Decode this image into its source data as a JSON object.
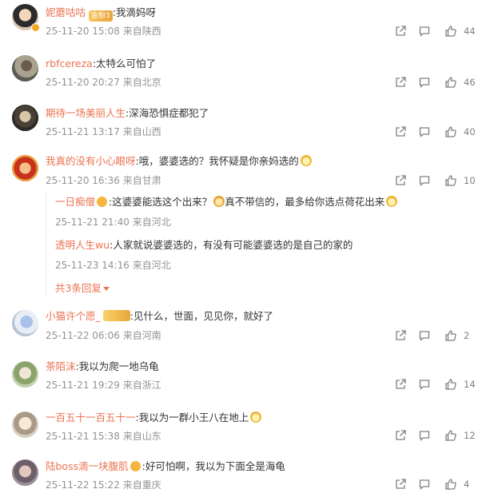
{
  "comments": [
    {
      "user": "妮蘑咕咕",
      "sep": ":",
      "text": "我滴妈呀",
      "time": "25-11-20 15:08",
      "location": "来自陕西",
      "likes": "44",
      "has_badge": true,
      "badge": "金粉3"
    },
    {
      "user": "rbfcereza",
      "sep": ":",
      "text": "太特么可怕了",
      "time": "25-11-20 20:27",
      "location": "来自北京",
      "likes": "46"
    },
    {
      "user": "期待一场美丽人生",
      "sep": ":",
      "text": "深海恐惧症都犯了",
      "time": "25-11-21 13:17",
      "location": "来自山西",
      "likes": "40"
    },
    {
      "user": "我真的没有小心眼呀",
      "sep": ":",
      "text": "哦，婆婆选的？我怀疑是你亲妈选的",
      "time": "25-11-20 16:36",
      "location": "来自甘肃",
      "likes": "10"
    },
    {
      "user": "小猫许个愿_",
      "sep": ":",
      "text": "见什么，世面，见见你，就好了",
      "time": "25-11-22 06:06",
      "location": "来自河南",
      "likes": "2"
    },
    {
      "user": "茶陌沫",
      "sep": ":",
      "text": "我以为爬一地乌龟",
      "time": "25-11-21 19:29",
      "location": "来自浙江",
      "likes": "14"
    },
    {
      "user": "一百五十一百五十一",
      "sep": ":",
      "text": "我以为一群小王八在地上",
      "time": "25-11-21 15:38",
      "location": "来自山东",
      "likes": "12"
    },
    {
      "user": "陆boss滴一块腹肌",
      "sep": ":",
      "text": "好可怕啊，我以为下面全是海龟",
      "time": "25-11-22 15:22",
      "location": "来自重庆",
      "likes": "4"
    }
  ],
  "replies": [
    {
      "user": "一日痴僧",
      "sep": ":",
      "text": "这婆婆能选这个出来？",
      "text2": "真不带信的，最多给你选点荷花出来",
      "time": "25-11-21 21:40",
      "location": "来自河北"
    },
    {
      "user": "透明人生wu",
      "sep": ":",
      "text": "人家就说婆婆选的，有没有可能婆婆选的是自己的家的",
      "time": "25-11-23 14:16",
      "location": "来自河北"
    }
  ],
  "more_replies": "共3条回复",
  "colors": {
    "username": "#eb7350",
    "meta": "#939393",
    "icon": "#808080"
  },
  "icons": [
    "share-icon",
    "comment-icon",
    "like-icon",
    "chevron-down-icon",
    "vip-badge-icon",
    "emoji-icon"
  ]
}
